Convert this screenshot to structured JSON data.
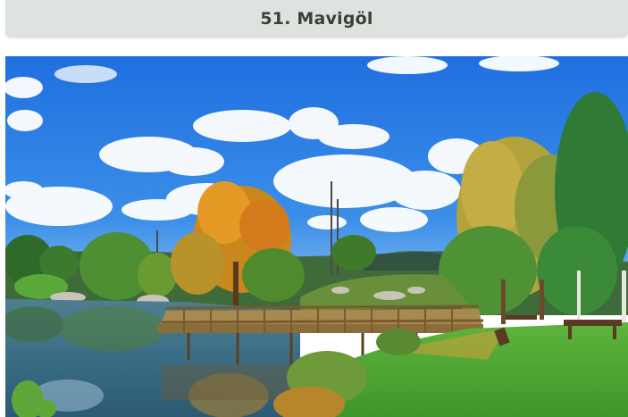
{
  "header": {
    "title": "51. Mavigöl"
  },
  "photo": {
    "subject": "lake-landscape",
    "colors": {
      "sky": "#2f7fe0",
      "water": "#3d6f85",
      "grass": "#4fa336",
      "autumn": "#d88a1e"
    }
  }
}
